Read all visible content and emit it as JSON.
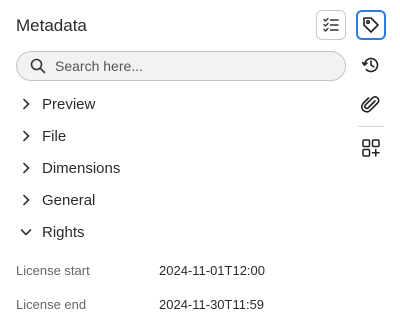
{
  "header": {
    "title": "Metadata",
    "checklist_icon": "checklist-icon"
  },
  "search": {
    "placeholder": "Search here...",
    "icon": "search-icon"
  },
  "sections": [
    {
      "label": "Preview",
      "expanded": false
    },
    {
      "label": "File",
      "expanded": false
    },
    {
      "label": "Dimensions",
      "expanded": false
    },
    {
      "label": "General",
      "expanded": false
    },
    {
      "label": "Rights",
      "expanded": true
    }
  ],
  "rights_fields": [
    {
      "key": "License start",
      "value": "2024-11-01T12:00"
    },
    {
      "key": "License end",
      "value": "2024-11-30T11:59"
    }
  ],
  "rail": {
    "active": "tag-icon",
    "items": [
      "tag-icon",
      "history-icon",
      "attachment-icon",
      "add-widget-icon"
    ],
    "accent": "#2a7de1"
  }
}
